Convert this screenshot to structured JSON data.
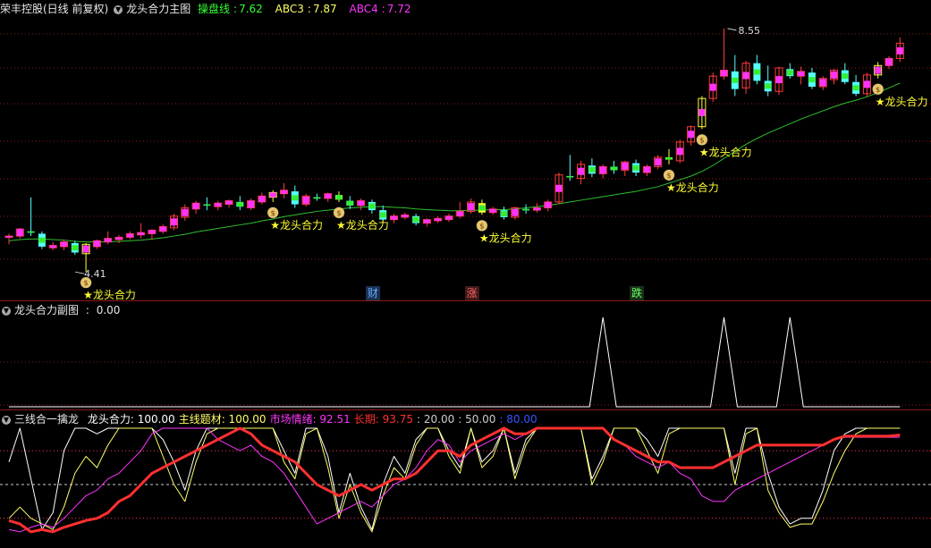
{
  "main_header": {
    "title": "荣丰控股(日线 前复权)",
    "indicator": "龙头合力主图",
    "line1_label": "操盘线",
    "line1_value": "7.62",
    "line2_label": "ABC3",
    "line2_value": "7.87",
    "line3_label": "ABC4",
    "line3_value": "7.72"
  },
  "sub1_header": {
    "label": "龙头合力副图",
    "value": "0.00"
  },
  "sub2_header": {
    "label": "三线合一擒龙",
    "items": [
      {
        "name": "龙头合力",
        "value": "100.00",
        "color": "#ffffff"
      },
      {
        "name": "主线题材",
        "value": "100.00",
        "color": "#ffff66"
      },
      {
        "name": "市场情绪",
        "value": "92.51",
        "color": "#ff33ff"
      },
      {
        "name": "长期",
        "value": "93.75",
        "color": "#ff3030"
      },
      {
        "name": "",
        "value": "20.00",
        "color": "#cccccc"
      },
      {
        "name": "",
        "value": "50.00",
        "color": "#cccccc"
      },
      {
        "name": "",
        "value": "80.00",
        "color": "#3355ff"
      }
    ]
  },
  "annotations": {
    "high_label": "8.55",
    "low_label": "4.41",
    "signal_label": "★龙头合力",
    "event_tags": [
      {
        "text": "财",
        "bar": 33,
        "color": "#66aaff",
        "bg": "#1a3050"
      },
      {
        "text": "涨",
        "bar": 42,
        "color": "#ff6666",
        "bg": "#401818"
      },
      {
        "text": "跌",
        "bar": 57,
        "color": "#66ff66",
        "bg": "#183018"
      }
    ]
  },
  "colors": {
    "up_hollow": "#ff3b3b",
    "down_solid": "#54ffff",
    "ma_line": "#2fbf2f",
    "signal_yellow": "#ffff33",
    "strong_up": "#ff33ff",
    "grid": "#8b1a1a"
  },
  "chart_data": [
    {
      "type": "candlestick",
      "price_range": [
        4.2,
        8.7
      ],
      "high": 8.55,
      "low": 4.41,
      "ohlc": [
        [
          5.0,
          5.06,
          4.88,
          5.02
        ],
        [
          5.02,
          5.16,
          4.98,
          5.14
        ],
        [
          5.1,
          5.68,
          5.02,
          5.08
        ],
        [
          5.06,
          5.1,
          4.8,
          4.84
        ],
        [
          4.82,
          4.92,
          4.78,
          4.86
        ],
        [
          4.84,
          4.96,
          4.78,
          4.92
        ],
        [
          4.9,
          4.94,
          4.7,
          4.74
        ],
        [
          4.72,
          4.9,
          4.41,
          4.88
        ],
        [
          4.84,
          4.96,
          4.8,
          4.94
        ],
        [
          4.92,
          5.1,
          4.88,
          4.98
        ],
        [
          4.96,
          5.04,
          4.9,
          5.0
        ],
        [
          5.0,
          5.1,
          4.96,
          5.06
        ],
        [
          5.04,
          5.24,
          4.98,
          5.08
        ],
        [
          5.06,
          5.14,
          4.96,
          5.12
        ],
        [
          5.1,
          5.22,
          5.06,
          5.18
        ],
        [
          5.16,
          5.4,
          5.12,
          5.36
        ],
        [
          5.34,
          5.56,
          5.28,
          5.5
        ],
        [
          5.48,
          5.62,
          5.4,
          5.58
        ],
        [
          5.56,
          5.68,
          5.46,
          5.54
        ],
        [
          5.52,
          5.62,
          5.46,
          5.58
        ],
        [
          5.56,
          5.64,
          5.5,
          5.62
        ],
        [
          5.6,
          5.7,
          5.46,
          5.52
        ],
        [
          5.5,
          5.66,
          5.46,
          5.62
        ],
        [
          5.6,
          5.76,
          5.56,
          5.7
        ],
        [
          5.68,
          5.8,
          5.6,
          5.76
        ],
        [
          5.74,
          5.92,
          5.66,
          5.8
        ],
        [
          5.78,
          5.88,
          5.5,
          5.56
        ],
        [
          5.56,
          5.74,
          5.52,
          5.7
        ],
        [
          5.68,
          5.74,
          5.62,
          5.66
        ],
        [
          5.66,
          5.76,
          5.6,
          5.74
        ],
        [
          5.72,
          5.78,
          5.6,
          5.64
        ],
        [
          5.62,
          5.7,
          5.48,
          5.54
        ],
        [
          5.54,
          5.66,
          5.46,
          5.62
        ],
        [
          5.6,
          5.64,
          5.4,
          5.46
        ],
        [
          5.46,
          5.54,
          5.26,
          5.3
        ],
        [
          5.3,
          5.4,
          5.24,
          5.36
        ],
        [
          5.34,
          5.42,
          5.3,
          5.38
        ],
        [
          5.36,
          5.4,
          5.2,
          5.24
        ],
        [
          5.24,
          5.32,
          5.18,
          5.3
        ],
        [
          5.28,
          5.36,
          5.24,
          5.32
        ],
        [
          5.3,
          5.4,
          5.26,
          5.36
        ],
        [
          5.36,
          5.6,
          5.32,
          5.44
        ],
        [
          5.44,
          5.66,
          5.4,
          5.6
        ],
        [
          5.58,
          5.64,
          5.38,
          5.42
        ],
        [
          5.42,
          5.52,
          5.38,
          5.48
        ],
        [
          5.46,
          5.52,
          5.3,
          5.34
        ],
        [
          5.34,
          5.52,
          5.3,
          5.5
        ],
        [
          5.48,
          5.56,
          5.4,
          5.46
        ],
        [
          5.46,
          5.58,
          5.42,
          5.5
        ],
        [
          5.5,
          5.64,
          5.44,
          5.6
        ],
        [
          5.6,
          6.1,
          5.56,
          6.06
        ],
        [
          6.04,
          6.4,
          5.96,
          6.02
        ],
        [
          6.0,
          6.3,
          5.9,
          6.24
        ],
        [
          6.22,
          6.34,
          6.02,
          6.08
        ],
        [
          6.08,
          6.24,
          6.0,
          6.2
        ],
        [
          6.2,
          6.3,
          6.08,
          6.14
        ],
        [
          6.14,
          6.3,
          6.04,
          6.28
        ],
        [
          6.26,
          6.32,
          6.04,
          6.1
        ],
        [
          6.1,
          6.24,
          6.04,
          6.2
        ],
        [
          6.2,
          6.4,
          6.16,
          6.36
        ],
        [
          6.36,
          6.5,
          6.24,
          6.32
        ],
        [
          6.3,
          6.66,
          6.26,
          6.62
        ],
        [
          6.62,
          6.9,
          6.56,
          6.88
        ],
        [
          6.88,
          7.4,
          6.84,
          7.36
        ],
        [
          7.36,
          7.8,
          7.3,
          7.74
        ],
        [
          7.74,
          8.55,
          7.68,
          7.84
        ],
        [
          7.82,
          8.1,
          7.4,
          7.52
        ],
        [
          7.54,
          8.0,
          7.44,
          7.96
        ],
        [
          7.96,
          8.1,
          7.6,
          7.66
        ],
        [
          7.66,
          7.92,
          7.4,
          7.48
        ],
        [
          7.48,
          7.9,
          7.42,
          7.88
        ],
        [
          7.86,
          7.96,
          7.7,
          7.74
        ],
        [
          7.74,
          7.9,
          7.6,
          7.82
        ],
        [
          7.8,
          7.88,
          7.52,
          7.56
        ],
        [
          7.56,
          7.74,
          7.5,
          7.7
        ],
        [
          7.68,
          7.86,
          7.6,
          7.84
        ],
        [
          7.84,
          7.96,
          7.6,
          7.64
        ],
        [
          7.64,
          7.76,
          7.4,
          7.44
        ],
        [
          7.44,
          7.8,
          7.4,
          7.76
        ],
        [
          7.76,
          7.98,
          7.7,
          7.92
        ],
        [
          7.92,
          8.08,
          7.86,
          8.04
        ],
        [
          8.04,
          8.4,
          7.98,
          8.3
        ]
      ],
      "ma_line": [
        4.94,
        4.96,
        4.97,
        4.97,
        4.96,
        4.95,
        4.93,
        4.92,
        4.92,
        4.92,
        4.93,
        4.94,
        4.95,
        4.97,
        4.99,
        5.02,
        5.05,
        5.09,
        5.12,
        5.15,
        5.18,
        5.21,
        5.24,
        5.28,
        5.31,
        5.35,
        5.38,
        5.41,
        5.44,
        5.46,
        5.48,
        5.5,
        5.51,
        5.52,
        5.52,
        5.51,
        5.5,
        5.48,
        5.47,
        5.46,
        5.45,
        5.45,
        5.46,
        5.46,
        5.47,
        5.47,
        5.48,
        5.5,
        5.52,
        5.54,
        5.57,
        5.6,
        5.63,
        5.66,
        5.69,
        5.72,
        5.75,
        5.78,
        5.82,
        5.86,
        5.92,
        5.98,
        6.04,
        6.12,
        6.22,
        6.34,
        6.46,
        6.58,
        6.68,
        6.77,
        6.85,
        6.93,
        7.01,
        7.08,
        7.15,
        7.22,
        7.28,
        7.33,
        7.39,
        7.46,
        7.54,
        7.62
      ],
      "signal_bars": [
        7,
        24,
        30,
        43,
        60,
        63,
        79
      ]
    },
    {
      "type": "line",
      "name": "龙头合力副图",
      "y_range": [
        0,
        100
      ],
      "spikes": [
        54,
        65,
        71
      ]
    },
    {
      "type": "line",
      "y_range": [
        0,
        100
      ],
      "reference_lines": [
        20,
        50,
        80
      ],
      "series": [
        {
          "name": "龙头合力",
          "color": "#ffffff",
          "values": [
            70,
            100,
            55,
            10,
            25,
            80,
            100,
            100,
            95,
            100,
            100,
            100,
            100,
            100,
            90,
            70,
            45,
            80,
            100,
            100,
            100,
            100,
            100,
            100,
            100,
            80,
            60,
            100,
            100,
            75,
            25,
            60,
            30,
            10,
            50,
            75,
            60,
            90,
            100,
            100,
            80,
            65,
            100,
            70,
            80,
            100,
            60,
            90,
            100,
            100,
            100,
            100,
            100,
            55,
            75,
            100,
            100,
            100,
            90,
            75,
            100,
            100,
            100,
            100,
            100,
            100,
            60,
            100,
            100,
            60,
            30,
            15,
            20,
            20,
            45,
            80,
            95,
            100,
            100,
            100,
            100,
            100
          ]
        },
        {
          "name": "主线题材",
          "color": "#ffff66",
          "values": [
            20,
            30,
            20,
            15,
            10,
            30,
            60,
            75,
            65,
            85,
            100,
            100,
            100,
            100,
            75,
            50,
            35,
            70,
            95,
            100,
            100,
            100,
            100,
            100,
            100,
            70,
            55,
            95,
            100,
            65,
            20,
            50,
            25,
            8,
            40,
            65,
            55,
            85,
            100,
            100,
            75,
            60,
            100,
            65,
            75,
            100,
            55,
            85,
            100,
            100,
            100,
            100,
            100,
            50,
            70,
            100,
            100,
            100,
            80,
            60,
            95,
            100,
            100,
            100,
            100,
            100,
            50,
            95,
            100,
            45,
            25,
            12,
            15,
            15,
            35,
            60,
            80,
            95,
            100,
            100,
            100,
            100
          ]
        },
        {
          "name": "市场情绪",
          "color": "#ff33ff",
          "values": [
            10,
            8,
            12,
            15,
            12,
            20,
            30,
            40,
            45,
            55,
            60,
            70,
            80,
            95,
            100,
            100,
            100,
            100,
            100,
            90,
            85,
            80,
            85,
            75,
            70,
            60,
            45,
            30,
            15,
            20,
            25,
            30,
            35,
            30,
            40,
            50,
            55,
            65,
            80,
            90,
            85,
            70,
            80,
            85,
            90,
            95,
            90,
            95,
            100,
            100,
            100,
            100,
            100,
            100,
            100,
            90,
            85,
            75,
            70,
            65,
            70,
            60,
            55,
            40,
            35,
            35,
            45,
            50,
            55,
            60,
            65,
            70,
            75,
            80,
            85,
            90,
            92,
            92,
            92,
            92,
            92,
            92
          ]
        },
        {
          "name": "长期",
          "color": "#ff3030",
          "values": [
            18,
            15,
            8,
            10,
            8,
            12,
            15,
            18,
            20,
            25,
            35,
            40,
            50,
            60,
            65,
            70,
            75,
            80,
            85,
            90,
            95,
            100,
            95,
            85,
            80,
            75,
            70,
            60,
            50,
            45,
            40,
            45,
            50,
            45,
            50,
            55,
            55,
            60,
            70,
            80,
            80,
            75,
            85,
            90,
            95,
            100,
            95,
            95,
            100,
            100,
            100,
            100,
            100,
            100,
            100,
            90,
            85,
            80,
            75,
            70,
            70,
            65,
            65,
            65,
            65,
            70,
            75,
            80,
            85,
            85,
            85,
            85,
            85,
            85,
            85,
            90,
            93,
            93,
            93,
            93,
            93,
            94
          ]
        }
      ]
    }
  ]
}
